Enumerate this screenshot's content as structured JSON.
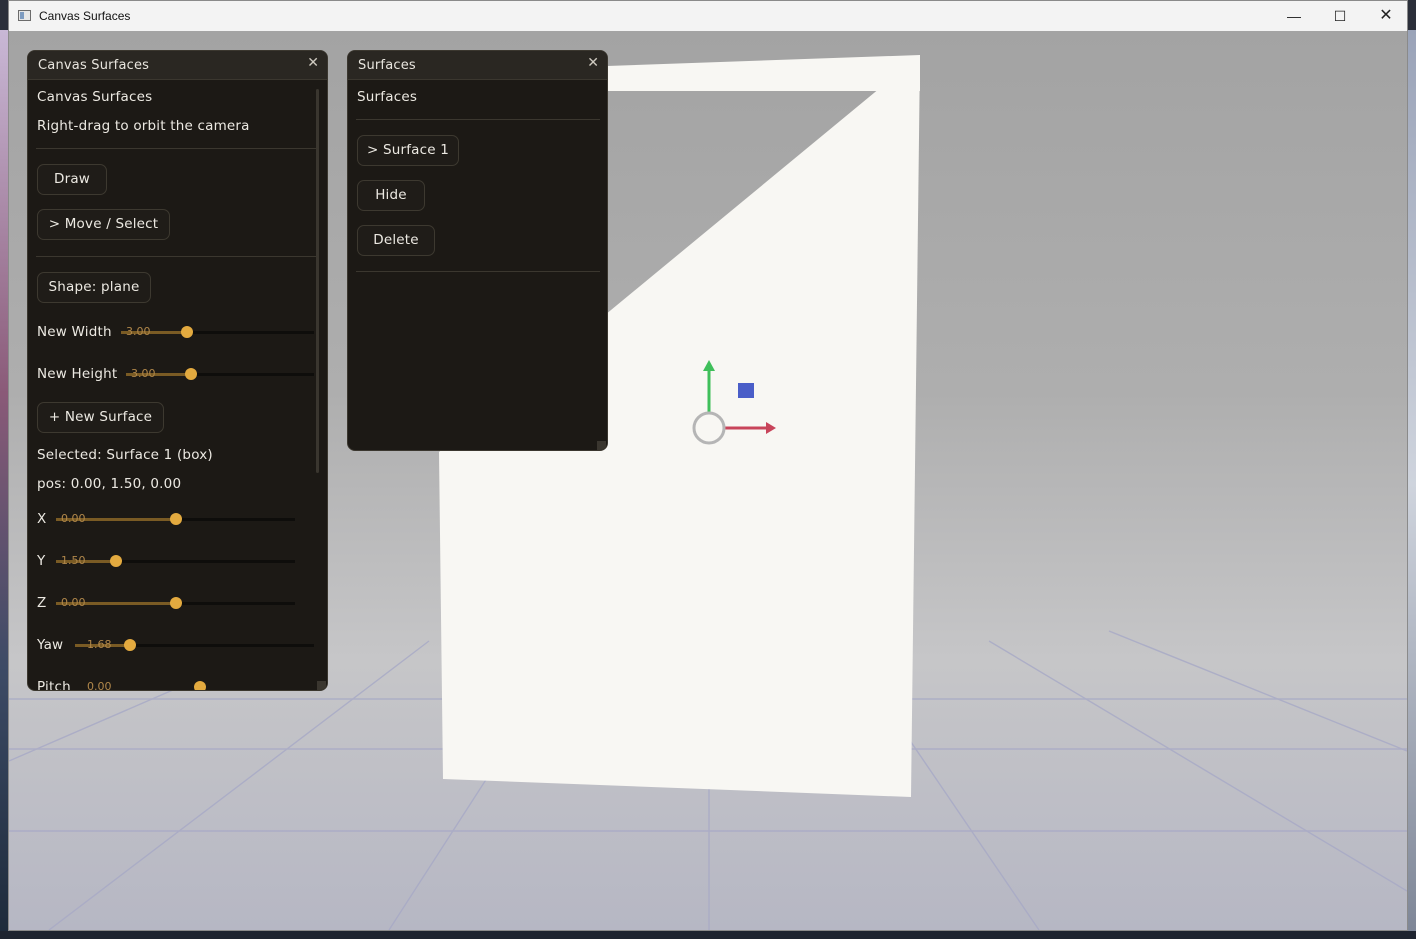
{
  "window": {
    "title": "Canvas Surfaces",
    "min_label": "—",
    "max_label": "☐",
    "close_label": "✕"
  },
  "scene": {
    "plane_color": "#f8f7f3",
    "gizmo": {
      "y_axis_color": "#3fbf5a",
      "x_axis_color": "#c8445a",
      "z_handle_color": "#4a5ec8",
      "ring_color": "#b5b5b5"
    }
  },
  "left_panel": {
    "title": "Canvas Surfaces",
    "close": "✕",
    "heading": "Canvas Surfaces",
    "hint": "Right-drag to orbit the camera",
    "draw_button": "Draw",
    "move_button": "> Move / Select",
    "shape_button": "Shape: plane",
    "new_width": {
      "label": "New Width",
      "value": "3.00",
      "fraction": 0.35
    },
    "new_height": {
      "label": "New Height",
      "value": "3.00",
      "fraction": 0.35
    },
    "new_surface_button": "+ New Surface",
    "selected": "Selected: Surface 1 (box)",
    "pos": "pos: 0.00, 1.50, 0.00",
    "x": {
      "label": "X",
      "value": "0.00",
      "fraction": 0.5
    },
    "y": {
      "label": "Y",
      "value": "1.50",
      "fraction": 0.25
    },
    "z": {
      "label": "Z",
      "value": "0.00",
      "fraction": 0.5
    },
    "yaw": {
      "label": "Yaw",
      "value": "1.68",
      "fraction": 0.23
    },
    "pitch": {
      "label": "Pitch",
      "value": "0.00"
    }
  },
  "right_panel": {
    "title": "Surfaces",
    "close": "✕",
    "heading": "Surfaces",
    "surface_item": "> Surface 1",
    "hide_button": "Hide",
    "delete_button": "Delete"
  }
}
